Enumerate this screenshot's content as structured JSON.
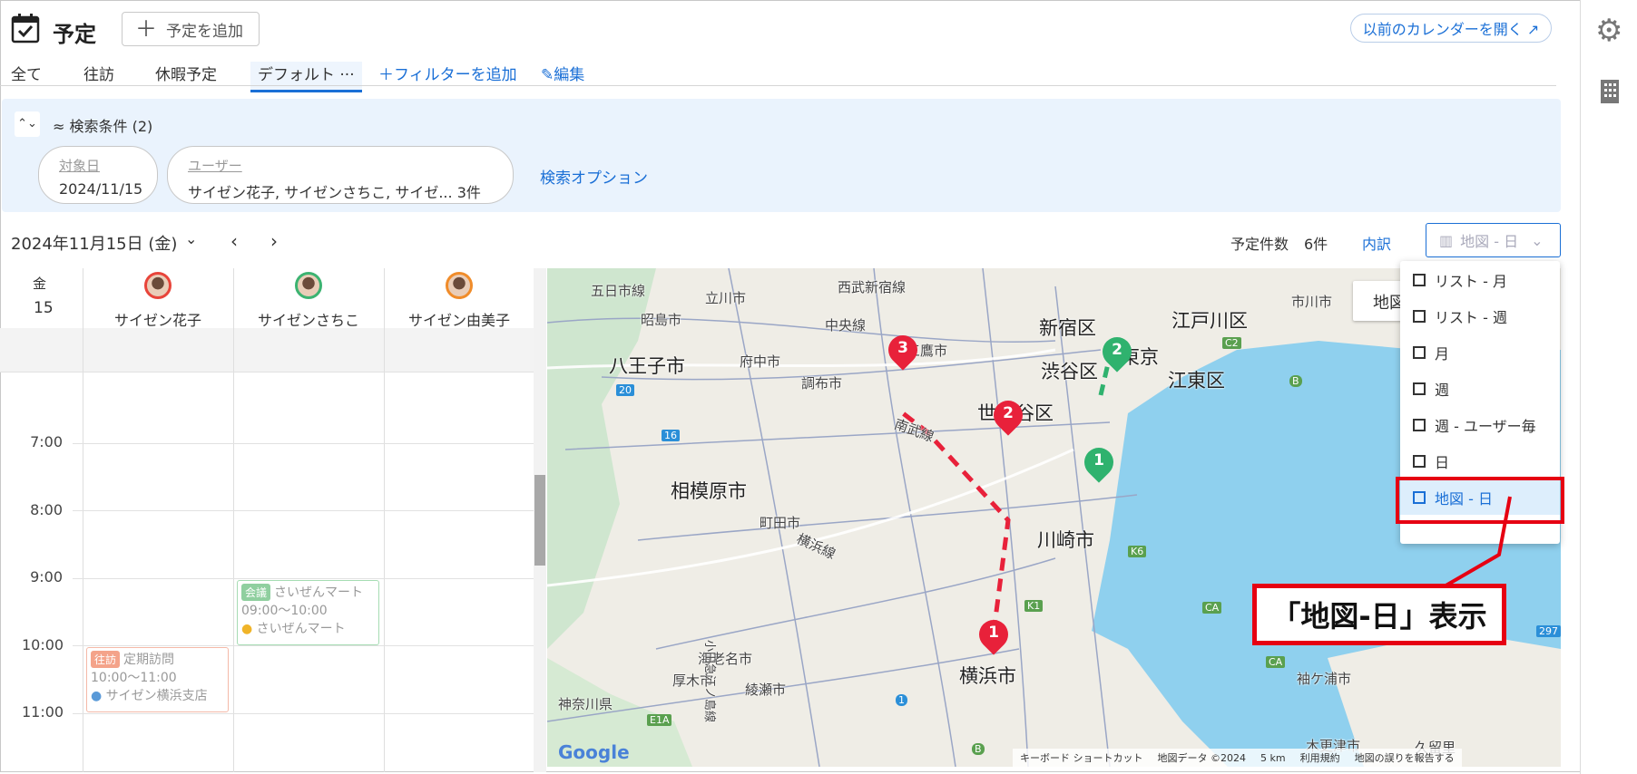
{
  "header": {
    "title": "予定",
    "add_button": "予定を追加",
    "old_calendar": "以前のカレンダーを開く ↗"
  },
  "tabs": [
    {
      "label": "全て"
    },
    {
      "label": "往訪"
    },
    {
      "label": "休暇予定"
    },
    {
      "label": "デフォルト ···"
    }
  ],
  "add_filter": "フィルターを追加",
  "edit": "編集",
  "search": {
    "label": "検索条件 (2)",
    "date_label": "対象日",
    "date_value": "2024/11/15",
    "user_label": "ユーザー",
    "user_value": "サイゼン花子, サイゼンさちこ, サイゼ... 3件",
    "options": "検索オプション"
  },
  "toolbar": {
    "date": "2024年11月15日 (金)",
    "count_label": "予定件数",
    "count_value": "6件",
    "breakdown": "内訳",
    "view_selected": "地図 - 日"
  },
  "calendar": {
    "day_name": "金",
    "day_num": "15",
    "users": [
      {
        "name": "サイゼン花子",
        "color": "#e8443a"
      },
      {
        "name": "サイゼンさちこ",
        "color": "#3cb371"
      },
      {
        "name": "サイゼン由美子",
        "color": "#f08c2a"
      }
    ],
    "times": [
      "7:00",
      "8:00",
      "9:00",
      "10:00",
      "11:00"
    ],
    "events": [
      {
        "tag": "会議",
        "title": "さいぜんマート",
        "time": "09:00〜10:00",
        "place": "さいぜんマート",
        "tag_color": "#8fcf9f"
      },
      {
        "tag": "往訪",
        "title": "定期訪問",
        "time": "10:00〜11:00",
        "place": "サイゼン横浜支店",
        "tag_color": "#f4a38a"
      }
    ]
  },
  "map": {
    "partial_button": "地図",
    "labels": [
      "五日市線",
      "立川市",
      "西武新宿線",
      "昭島市",
      "中央線",
      "三鷹市",
      "新宿区",
      "江戸川区",
      "市川市",
      "八王子市",
      "府中市",
      "渋谷区",
      "東京",
      "江東区",
      "調布市",
      "南武線",
      "世田谷区",
      "相模原市",
      "町田市",
      "横浜線",
      "川崎市",
      "海老名市",
      "厚木市",
      "綾瀬市",
      "小田急江ノ島線",
      "横浜市",
      "神奈川県",
      "袖ケ浦市",
      "木更津市",
      "久留里"
    ],
    "attribution": [
      "キーボード ショートカット",
      "地図データ ©2024",
      "5 km",
      "利用規約",
      "地図の誤りを報告する"
    ],
    "google": "Google",
    "markers": [
      {
        "n": "1",
        "color": "#e8213a"
      },
      {
        "n": "2",
        "color": "#e8213a"
      },
      {
        "n": "3",
        "color": "#e8213a"
      },
      {
        "n": "1",
        "color": "#2fb26e"
      },
      {
        "n": "2",
        "color": "#2fb26e"
      }
    ],
    "road_numbers": [
      "20",
      "16",
      "C2",
      "B",
      "K6",
      "K1",
      "CA",
      "CA",
      "297",
      "E1A",
      "1",
      "B"
    ]
  },
  "view_menu": {
    "items": [
      "リスト - 月",
      "リスト - 週",
      "月",
      "週",
      "週 - ユーザー毎",
      "日",
      "地図 - 日"
    ],
    "selected_index": 6
  },
  "annotation": "「地図-日」表示"
}
